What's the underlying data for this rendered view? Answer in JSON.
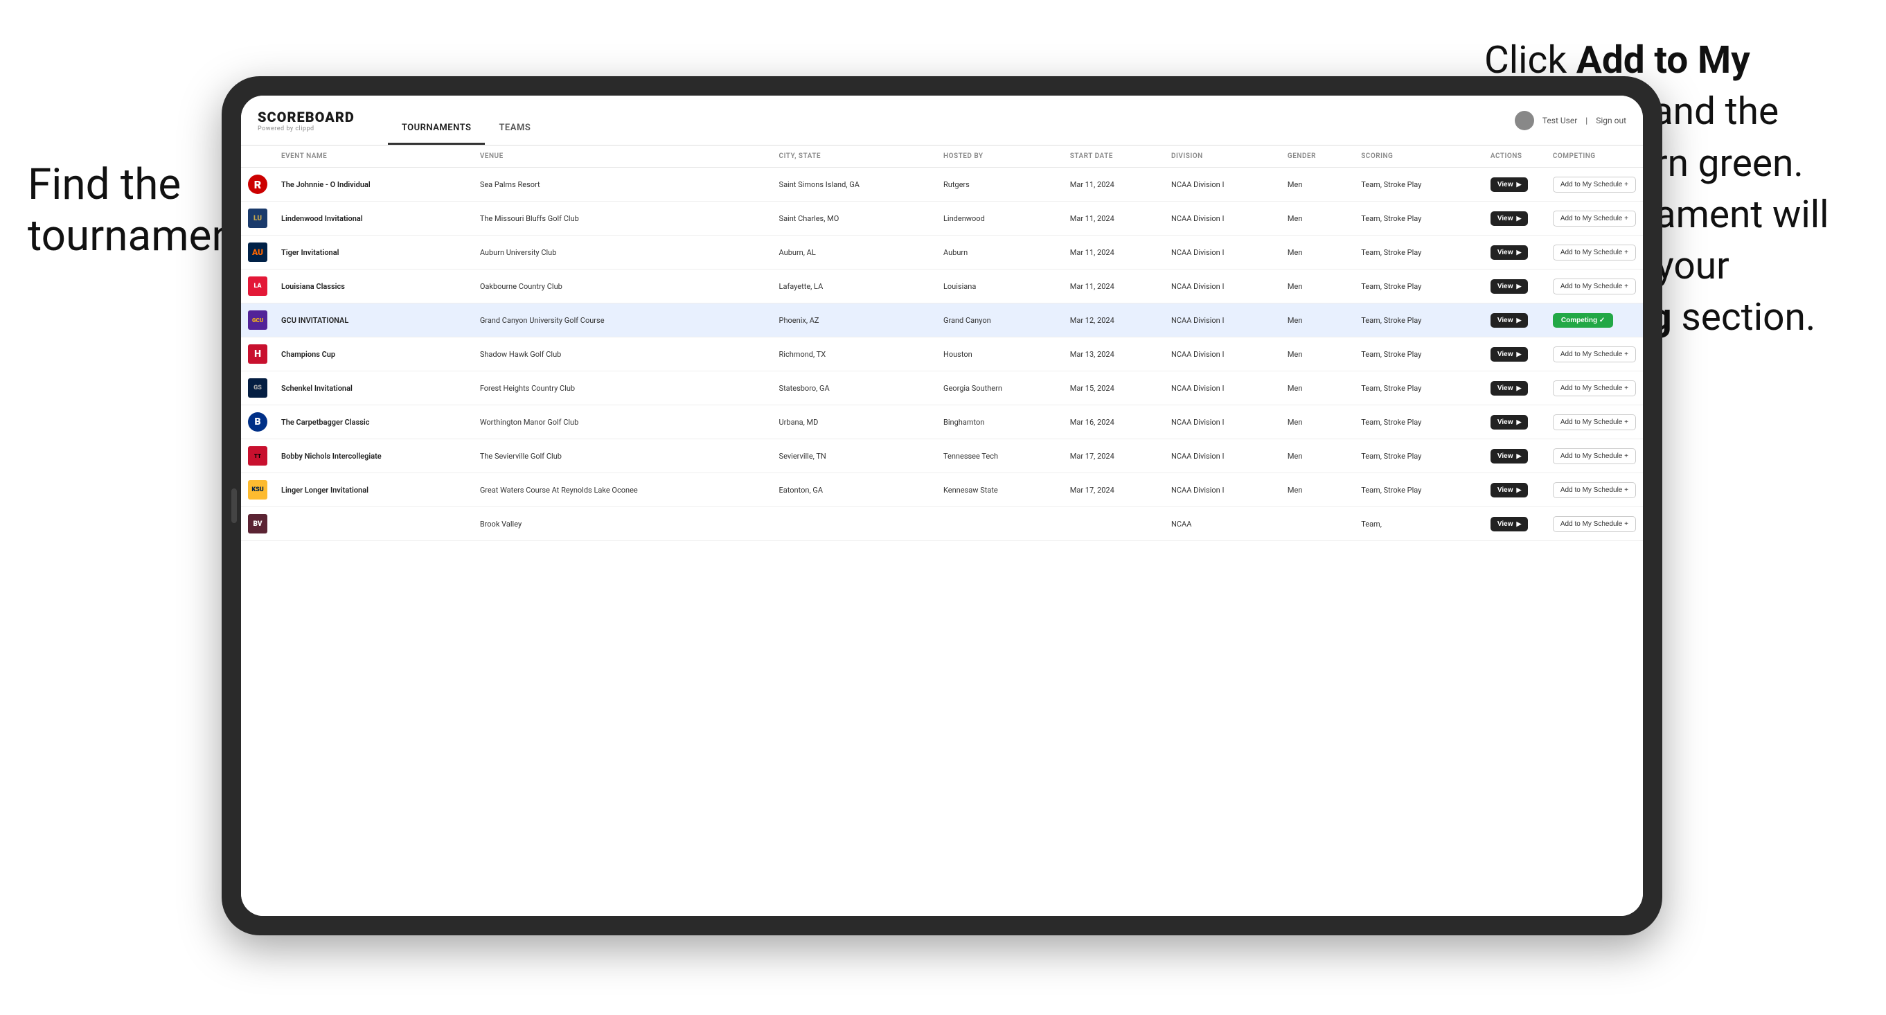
{
  "annotations": {
    "left": "Find the\ntournament.",
    "right_line1": "Click ",
    "right_bold1": "Add to My\nSchedule",
    "right_line2": " and the box will turn green. This tournament will now be in your ",
    "right_bold2": "Competing",
    "right_line3": " section."
  },
  "header": {
    "logo": "SCOREBOARD",
    "logo_sub": "Powered by clippd",
    "nav": [
      "TOURNAMENTS",
      "TEAMS"
    ],
    "active_nav": "TOURNAMENTS",
    "user_label": "Test User",
    "signout_label": "Sign out"
  },
  "table": {
    "columns": [
      "EVENT NAME",
      "VENUE",
      "CITY, STATE",
      "HOSTED BY",
      "START DATE",
      "DIVISION",
      "GENDER",
      "SCORING",
      "ACTIONS",
      "COMPETING"
    ],
    "rows": [
      {
        "logo_class": "logo-r",
        "logo_text": "R",
        "event": "The Johnnie - O Individual",
        "venue": "Sea Palms Resort",
        "city_state": "Saint Simons Island, GA",
        "hosted_by": "Rutgers",
        "start_date": "Mar 11, 2024",
        "division": "NCAA Division I",
        "gender": "Men",
        "scoring": "Team, Stroke Play",
        "competing": "add",
        "highlighted": false
      },
      {
        "logo_class": "logo-l",
        "logo_text": "LU",
        "event": "Lindenwood Invitational",
        "venue": "The Missouri Bluffs Golf Club",
        "city_state": "Saint Charles, MO",
        "hosted_by": "Lindenwood",
        "start_date": "Mar 11, 2024",
        "division": "NCAA Division I",
        "gender": "Men",
        "scoring": "Team, Stroke Play",
        "competing": "add",
        "highlighted": false
      },
      {
        "logo_class": "logo-a",
        "logo_text": "AU",
        "event": "Tiger Invitational",
        "venue": "Auburn University Club",
        "city_state": "Auburn, AL",
        "hosted_by": "Auburn",
        "start_date": "Mar 11, 2024",
        "division": "NCAA Division I",
        "gender": "Men",
        "scoring": "Team, Stroke Play",
        "competing": "add",
        "highlighted": false
      },
      {
        "logo_class": "logo-la",
        "logo_text": "LA",
        "event": "Louisiana Classics",
        "venue": "Oakbourne Country Club",
        "city_state": "Lafayette, LA",
        "hosted_by": "Louisiana",
        "start_date": "Mar 11, 2024",
        "division": "NCAA Division I",
        "gender": "Men",
        "scoring": "Team, Stroke Play",
        "competing": "add",
        "highlighted": false
      },
      {
        "logo_class": "logo-gcu",
        "logo_text": "GCU",
        "event": "GCU INVITATIONAL",
        "venue": "Grand Canyon University Golf Course",
        "city_state": "Phoenix, AZ",
        "hosted_by": "Grand Canyon",
        "start_date": "Mar 12, 2024",
        "division": "NCAA Division I",
        "gender": "Men",
        "scoring": "Team, Stroke Play",
        "competing": "competing",
        "highlighted": true
      },
      {
        "logo_class": "logo-h",
        "logo_text": "H",
        "event": "Champions Cup",
        "venue": "Shadow Hawk Golf Club",
        "city_state": "Richmond, TX",
        "hosted_by": "Houston",
        "start_date": "Mar 13, 2024",
        "division": "NCAA Division I",
        "gender": "Men",
        "scoring": "Team, Stroke Play",
        "competing": "add",
        "highlighted": false
      },
      {
        "logo_class": "logo-gs",
        "logo_text": "GS",
        "event": "Schenkel Invitational",
        "venue": "Forest Heights Country Club",
        "city_state": "Statesboro, GA",
        "hosted_by": "Georgia Southern",
        "start_date": "Mar 15, 2024",
        "division": "NCAA Division I",
        "gender": "Men",
        "scoring": "Team, Stroke Play",
        "competing": "add",
        "highlighted": false
      },
      {
        "logo_class": "logo-b",
        "logo_text": "B",
        "event": "The Carpetbagger Classic",
        "venue": "Worthington Manor Golf Club",
        "city_state": "Urbana, MD",
        "hosted_by": "Binghamton",
        "start_date": "Mar 16, 2024",
        "division": "NCAA Division I",
        "gender": "Men",
        "scoring": "Team, Stroke Play",
        "competing": "add",
        "highlighted": false
      },
      {
        "logo_class": "logo-tt",
        "logo_text": "TT",
        "event": "Bobby Nichols Intercollegiate",
        "venue": "The Sevierville Golf Club",
        "city_state": "Sevierville, TN",
        "hosted_by": "Tennessee Tech",
        "start_date": "Mar 17, 2024",
        "division": "NCAA Division I",
        "gender": "Men",
        "scoring": "Team, Stroke Play",
        "competing": "add",
        "highlighted": false
      },
      {
        "logo_class": "logo-k",
        "logo_text": "KSU",
        "event": "Linger Longer Invitational",
        "venue": "Great Waters Course At Reynolds Lake Oconee",
        "city_state": "Eatonton, GA",
        "hosted_by": "Kennesaw State",
        "start_date": "Mar 17, 2024",
        "division": "NCAA Division I",
        "gender": "Men",
        "scoring": "Team, Stroke Play",
        "competing": "add",
        "highlighted": false
      },
      {
        "logo_class": "logo-br",
        "logo_text": "BV",
        "event": "",
        "venue": "Brook Valley",
        "city_state": "",
        "hosted_by": "",
        "start_date": "",
        "division": "NCAA",
        "gender": "",
        "scoring": "Team,",
        "competing": "add",
        "highlighted": false
      }
    ],
    "btn_view": "View",
    "btn_add": "Add to My Schedule +",
    "btn_competing": "Competing ✓"
  }
}
